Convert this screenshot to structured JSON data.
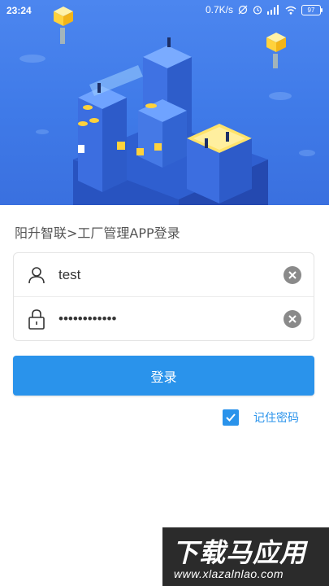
{
  "status_bar": {
    "time": "23:24",
    "network_speed": "0.7K/s",
    "battery": "97",
    "icons": [
      "alarm-off-icon",
      "alarm-clock-icon",
      "signal-icon",
      "wifi-icon",
      "battery-icon"
    ]
  },
  "page": {
    "title": "阳升智联>工厂管理APP登录"
  },
  "form": {
    "username": {
      "value": "test",
      "icon": "user-icon",
      "clear_icon": "clear-icon"
    },
    "password": {
      "value": "••••••••••••",
      "icon": "lock-icon",
      "clear_icon": "clear-icon"
    }
  },
  "login_button": {
    "label": "登录"
  },
  "remember": {
    "label": "记住密码",
    "checked": true
  },
  "watermark": {
    "main": "下载马应用",
    "sub": "www.xlazalnlao.com"
  },
  "colors": {
    "accent": "#2a93eb",
    "hero": "#4c86ef"
  }
}
